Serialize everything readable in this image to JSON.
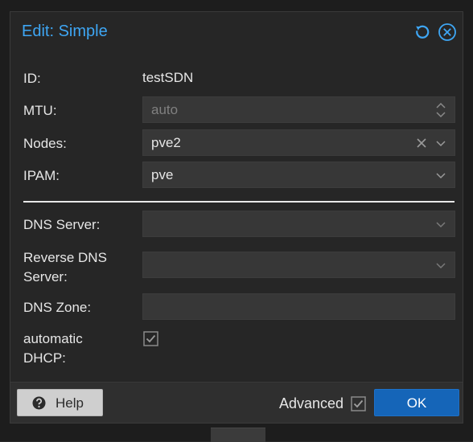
{
  "dialog": {
    "title": "Edit: Simple"
  },
  "form": {
    "id": {
      "label": "ID:",
      "value": "testSDN"
    },
    "mtu": {
      "label": "MTU:",
      "placeholder": "auto"
    },
    "nodes": {
      "label": "Nodes:",
      "value": "pve2"
    },
    "ipam": {
      "label": "IPAM:",
      "value": "pve"
    },
    "dns_server": {
      "label": "DNS Server:",
      "value": ""
    },
    "reverse_dns_server": {
      "label_line1": "Reverse DNS",
      "label_line2": "Server:",
      "value": ""
    },
    "dns_zone": {
      "label": "DNS Zone:",
      "value": ""
    },
    "automatic_dhcp": {
      "label_line1": "automatic",
      "label_line2": "DHCP:",
      "checked": true
    }
  },
  "footer": {
    "help_label": "Help",
    "advanced_label": "Advanced",
    "advanced_checked": true,
    "ok_label": "OK"
  },
  "colors": {
    "title": "#3ea6f4",
    "ok_button": "#1565b8",
    "panel": "#262626",
    "field": "#373737"
  }
}
